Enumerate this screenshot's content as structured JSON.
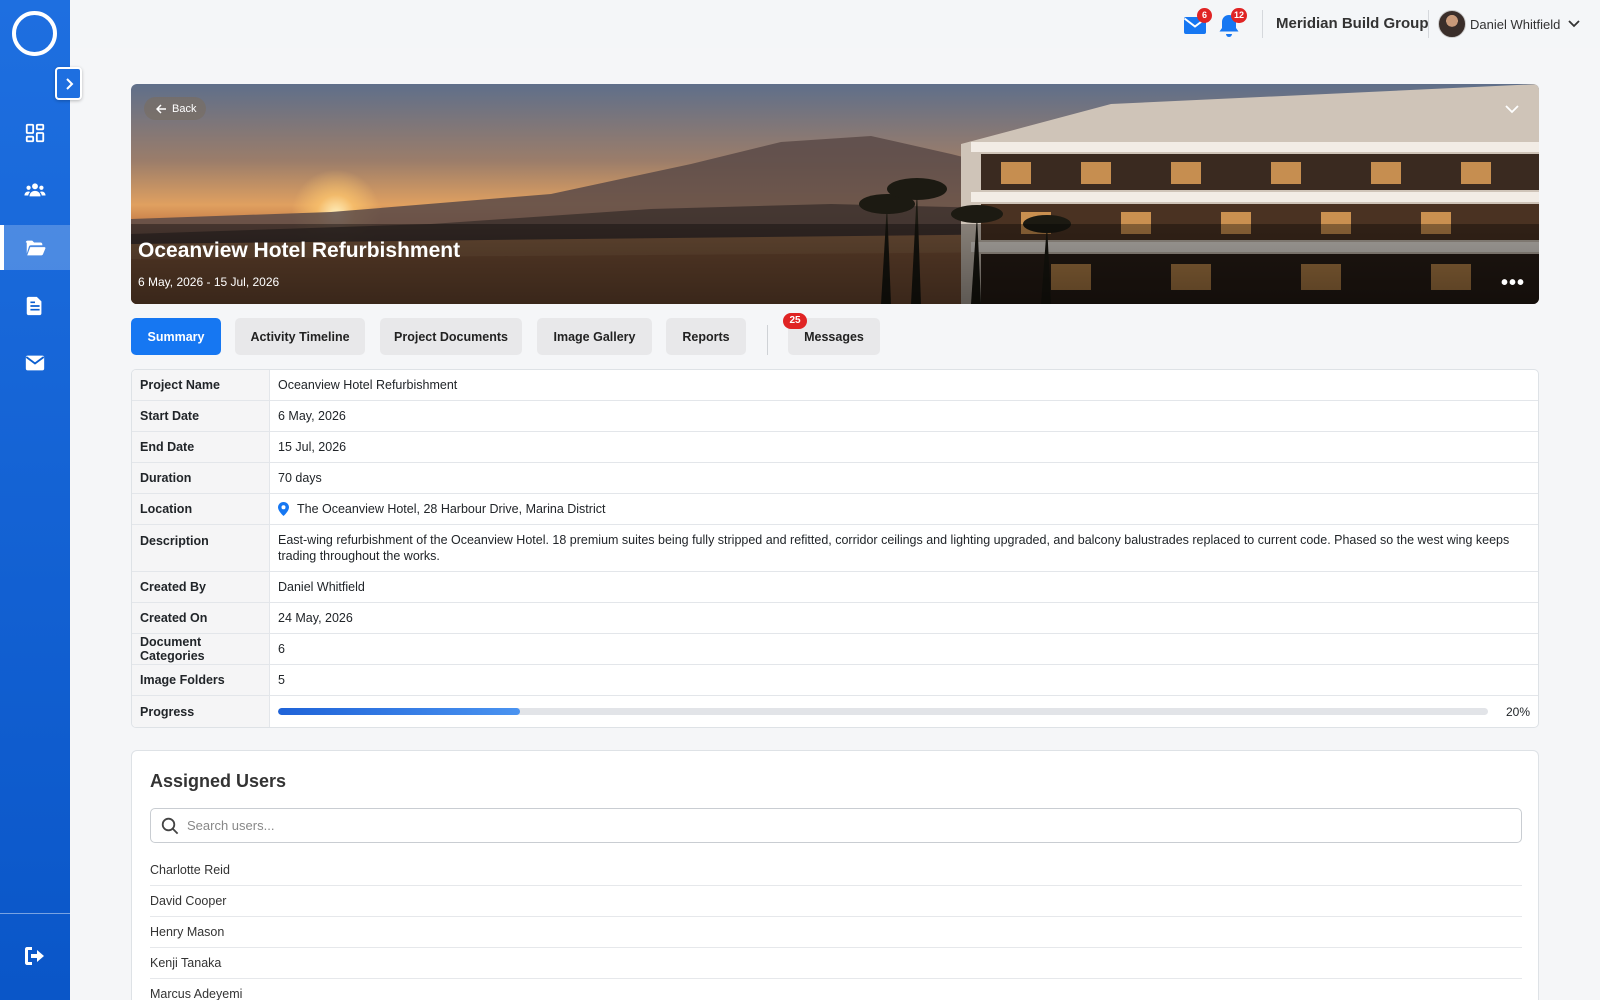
{
  "topbar": {
    "mail_count": "6",
    "notification_count": "12",
    "company": "Meridian Build Group",
    "user_name": "Daniel Whitfield"
  },
  "sidebar": {
    "items": [
      {
        "icon": "dashboard-icon",
        "active": false
      },
      {
        "icon": "users-icon",
        "active": false
      },
      {
        "icon": "folder-open-icon",
        "active": true
      },
      {
        "icon": "document-icon",
        "active": false
      },
      {
        "icon": "envelope-icon",
        "active": false
      }
    ],
    "logout_icon": "logout-icon"
  },
  "hero": {
    "back_label": "Back",
    "title": "Oceanview Hotel Refurbishment",
    "dates": "6 May, 2026 - 15 Jul, 2026"
  },
  "tabs": [
    {
      "label": "Summary",
      "active": true
    },
    {
      "label": "Activity Timeline",
      "active": false
    },
    {
      "label": "Project Documents",
      "active": false
    },
    {
      "label": "Image Gallery",
      "active": false
    },
    {
      "label": "Reports",
      "active": false
    },
    {
      "label": "Messages",
      "active": false,
      "badge": "25"
    }
  ],
  "details": {
    "project_name": {
      "label": "Project Name",
      "value": "Oceanview Hotel Refurbishment"
    },
    "start_date": {
      "label": "Start Date",
      "value": "6 May, 2026"
    },
    "end_date": {
      "label": "End Date",
      "value": "15 Jul, 2026"
    },
    "duration": {
      "label": "Duration",
      "value": "70 days"
    },
    "location": {
      "label": "Location",
      "value": "The Oceanview Hotel, 28 Harbour Drive, Marina District"
    },
    "description": {
      "label": "Description",
      "value": "East-wing refurbishment of the Oceanview Hotel. 18 premium suites being fully stripped and refitted, corridor ceilings and lighting upgraded, and balcony balustrades replaced to current code. Phased so the west wing keeps trading throughout the works."
    },
    "created_by": {
      "label": "Created By",
      "value": "Daniel Whitfield"
    },
    "created_on": {
      "label": "Created On",
      "value": "24 May, 2026"
    },
    "document_categories": {
      "label": "Document Categories",
      "value": "6"
    },
    "image_folders": {
      "label": "Image Folders",
      "value": "5"
    },
    "progress": {
      "label": "Progress",
      "value": 0.2,
      "text": "20%"
    }
  },
  "assigned_users": {
    "title": "Assigned Users",
    "search_placeholder": "Search users...",
    "users": [
      "Charlotte Reid",
      "David Cooper",
      "Henry Mason",
      "Kenji Tanaka",
      "Marcus Adeyemi"
    ]
  },
  "colors": {
    "primary": "#1677f2",
    "sidebar": "#0a56c8",
    "badge": "#e02424"
  }
}
